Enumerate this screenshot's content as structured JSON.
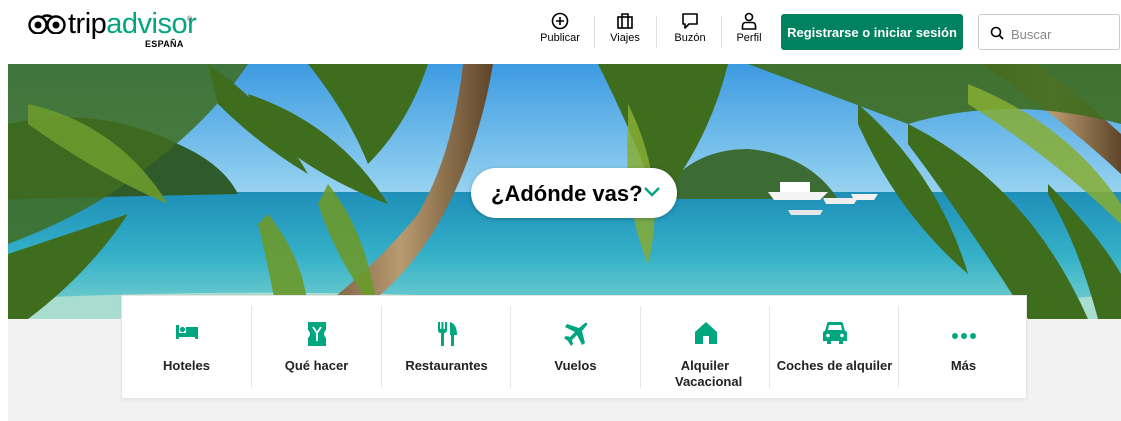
{
  "header": {
    "logo": {
      "brand": "tripadvisor",
      "brand_prefix": "trip",
      "brand_suffix": "advisor",
      "region": "ESPAÑA",
      "trademark": "®"
    },
    "nav": [
      {
        "label": "Publicar",
        "icon": "plus-circle-icon"
      },
      {
        "label": "Viajes",
        "icon": "suitcase-icon"
      },
      {
        "label": "Buzón",
        "icon": "chat-bubble-icon"
      },
      {
        "label": "Perfil",
        "icon": "person-icon"
      }
    ],
    "login_label": "Registrarse o iniciar sesión",
    "search": {
      "placeholder": "Buscar",
      "value": "",
      "icon": "search-icon"
    }
  },
  "hero": {
    "prompt": "¿Adónde vas?",
    "prompt_icon": "chevron-down-icon"
  },
  "categories": [
    {
      "label": "Hoteles",
      "icon": "bed-icon"
    },
    {
      "label": "Qué hacer",
      "icon": "ticket-icon"
    },
    {
      "label": "Restaurantes",
      "icon": "fork-knife-icon"
    },
    {
      "label": "Vuelos",
      "icon": "airplane-icon"
    },
    {
      "label": "Alquiler Vacacional",
      "icon": "house-icon"
    },
    {
      "label": "Coches de alquiler",
      "icon": "car-icon"
    },
    {
      "label": "Más",
      "icon": "more-dots-icon"
    }
  ],
  "colors": {
    "brand_green": "#00a680",
    "button_green": "#00815f",
    "icon_green": "#00a680",
    "sea": "#2fa9c4",
    "sky": "#6cc3ea"
  }
}
